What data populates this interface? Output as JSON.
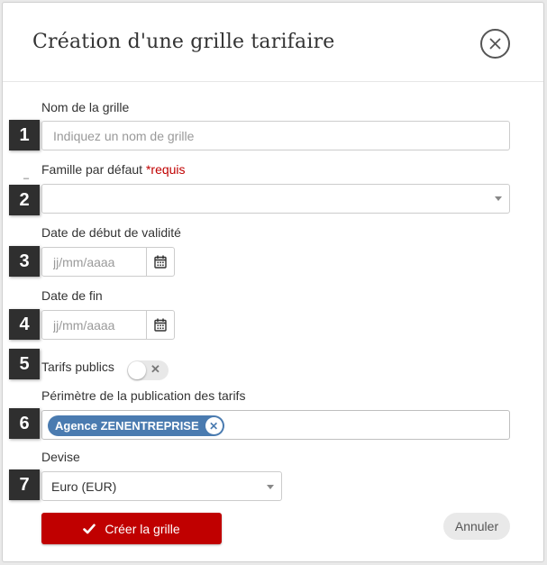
{
  "dialog": {
    "title": "Création d'une grille tarifaire"
  },
  "badges": [
    "1",
    "2",
    "3",
    "4",
    "5",
    "6",
    "7"
  ],
  "fields": {
    "name": {
      "label": "Nom de la grille",
      "placeholder": "Indiquez un nom de grille",
      "value": ""
    },
    "family": {
      "label": "Famille par défaut",
      "required_text": "*requis",
      "value": ""
    },
    "start_date": {
      "label": "Date de début de validité",
      "placeholder": "jj/mm/aaaa"
    },
    "end_date": {
      "label": "Date de fin",
      "placeholder": "jj/mm/aaaa"
    },
    "public_rates": {
      "label": "Tarifs publics",
      "enabled": false
    },
    "scope": {
      "label": "Périmètre de la publication des tarifs",
      "tags": [
        "Agence ZENENTREPRISE"
      ]
    },
    "currency": {
      "label": "Devise",
      "value": "Euro (EUR)"
    }
  },
  "actions": {
    "create_label": "Créer la grille",
    "cancel_label": "Annuler"
  },
  "colors": {
    "primary": "#c00000",
    "tag": "#4a7bb0",
    "badge": "#2f2f2f"
  },
  "icons": {
    "close": "close-circle-icon",
    "calendar": "calendar-icon",
    "check": "check-icon",
    "caret": "chevron-down-icon"
  }
}
